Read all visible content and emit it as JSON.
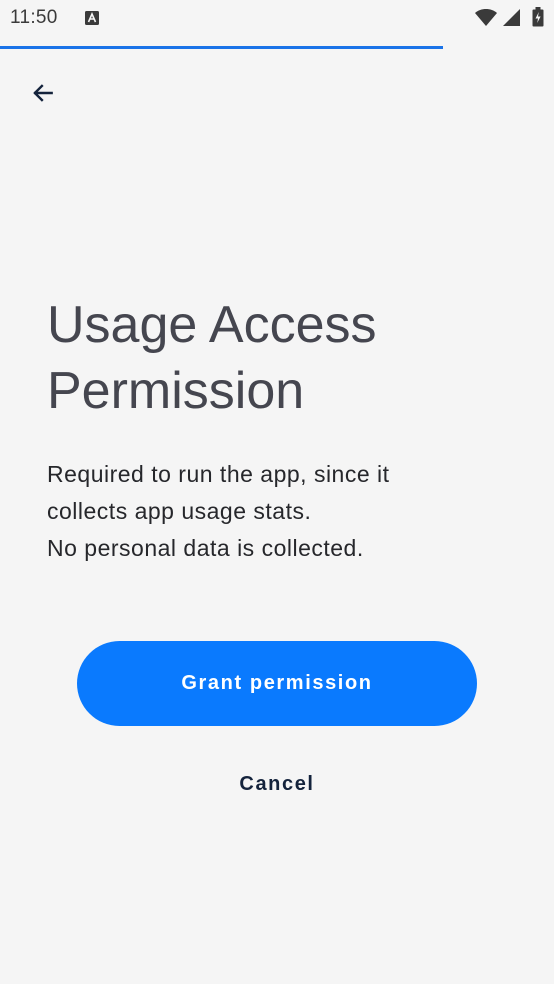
{
  "status_bar": {
    "time": "11:50",
    "notification_icon": "text-a-icon",
    "wifi_icon": "wifi-icon",
    "signal_icon": "cellular-signal-icon",
    "battery_icon": "battery-charging-icon"
  },
  "progress": {
    "fraction": 0.8
  },
  "header": {
    "back_icon": "arrow-left-icon"
  },
  "main": {
    "title": "Usage Access Permission",
    "description_lines": [
      "Required to run the app, since it",
      "collects app usage stats.",
      "No personal data is collected."
    ]
  },
  "actions": {
    "grant_label": "Grant permission",
    "cancel_label": "Cancel"
  },
  "colors": {
    "background": "#f5f5f5",
    "accent": "#0a7afe",
    "progress": "#1a73e8",
    "title_text": "#45464f",
    "body_text": "#26272b"
  }
}
